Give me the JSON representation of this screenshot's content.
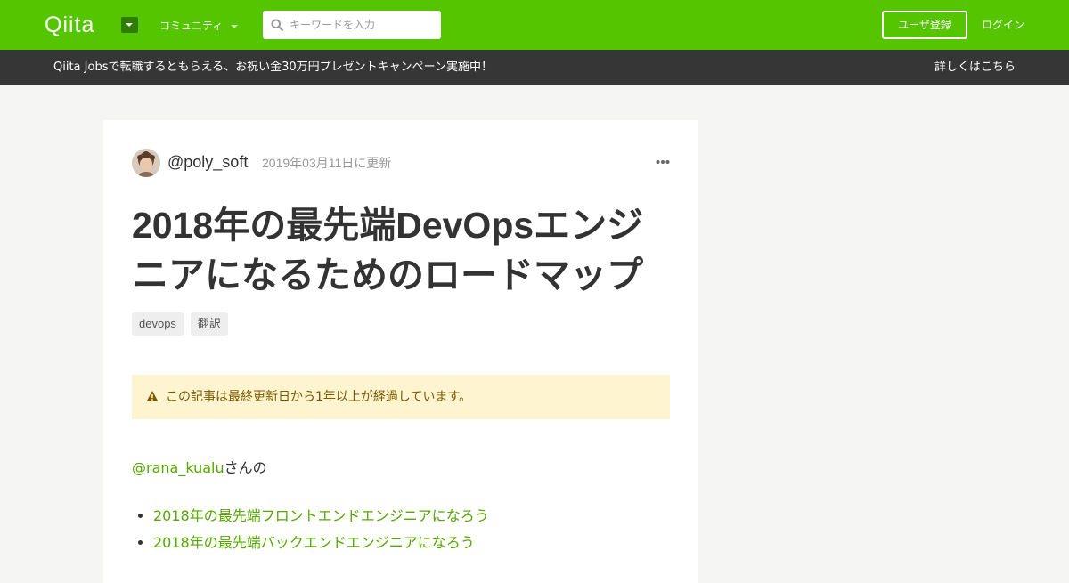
{
  "header": {
    "logo_text": "Qiita",
    "community_label": "コミュニティ",
    "search_placeholder": "キーワードを入力",
    "signup_label": "ユーザ登録",
    "login_label": "ログイン"
  },
  "banner": {
    "text": "Qiita Jobsで転職するともらえる、お祝い金30万円プレゼントキャンペーン実施中！",
    "link_label": "詳しくはこちら"
  },
  "article": {
    "author": "@poly_soft",
    "updated": "2019年03月11日に更新",
    "title": "2018年の最先端DevOpsエンジニアになるためのロードマップ",
    "tags": [
      "devops",
      "翻訳"
    ],
    "alert": "この記事は最終更新日から1年以上が経過しています。",
    "intro_link": "@rana_kualu",
    "intro_suffix": "さんの",
    "links": [
      "2018年の最先端フロントエンドエンジニアになろう",
      "2018年の最先端バックエンドエンジニアになろう"
    ]
  },
  "colors": {
    "brand": "#55c500",
    "banner_bg": "#363636",
    "link": "#55a800",
    "alert_bg": "#fff4d0"
  }
}
